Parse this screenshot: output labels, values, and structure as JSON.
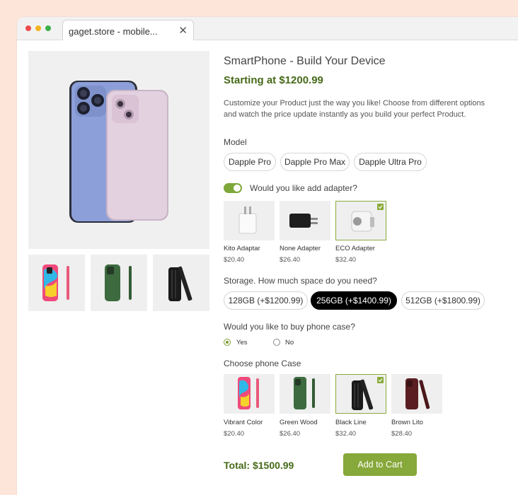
{
  "browser": {
    "tab_title": "gaget.store - mobile...",
    "close_glyph": "✕"
  },
  "product": {
    "title": "SmartPhone - Build Your Device",
    "starting_price": "Starting at $1200.99",
    "description": "Customize your Product just the way you like! Choose from different options and watch the price update instantly as you build your perfect Product."
  },
  "model": {
    "label": "Model",
    "options": [
      "Dapple Pro",
      "Dapple Pro Max",
      "Dapple Ultra Pro"
    ]
  },
  "adapter": {
    "toggle_label": "Would you like add adapter?",
    "toggle_on": true,
    "options": [
      {
        "name": "Kito Adaptar",
        "price": "$20.40",
        "selected": false
      },
      {
        "name": "None Adapter",
        "price": "$26.40",
        "selected": false
      },
      {
        "name": "ECO Adapter",
        "price": "$32.40",
        "selected": true
      }
    ]
  },
  "storage": {
    "label": "Storage. How much space do you need?",
    "options": [
      {
        "label": "128GB (+$1200.99)",
        "selected": false
      },
      {
        "label": "256GB (+$1400.99)",
        "selected": true
      },
      {
        "label": "512GB (+$1800.99)",
        "selected": false
      }
    ]
  },
  "case_question": {
    "label": "Would you like to buy phone case?",
    "yes": "Yes",
    "no": "No",
    "selected": "Yes"
  },
  "case": {
    "label": "Choose phone Case",
    "options": [
      {
        "name": "Vibrant Color",
        "price": "$20.40",
        "selected": false
      },
      {
        "name": "Green Wood",
        "price": "$26.40",
        "selected": false
      },
      {
        "name": "Black Line",
        "price": "$32.40",
        "selected": true
      },
      {
        "name": "Brown Lito",
        "price": "$28.40",
        "selected": false
      }
    ]
  },
  "footer": {
    "total": "Total: $1500.99",
    "cart_button": "Add to Cart"
  },
  "colors": {
    "accent_green": "#87a83a",
    "price_green": "#466a19",
    "selected_black": "#000000"
  }
}
